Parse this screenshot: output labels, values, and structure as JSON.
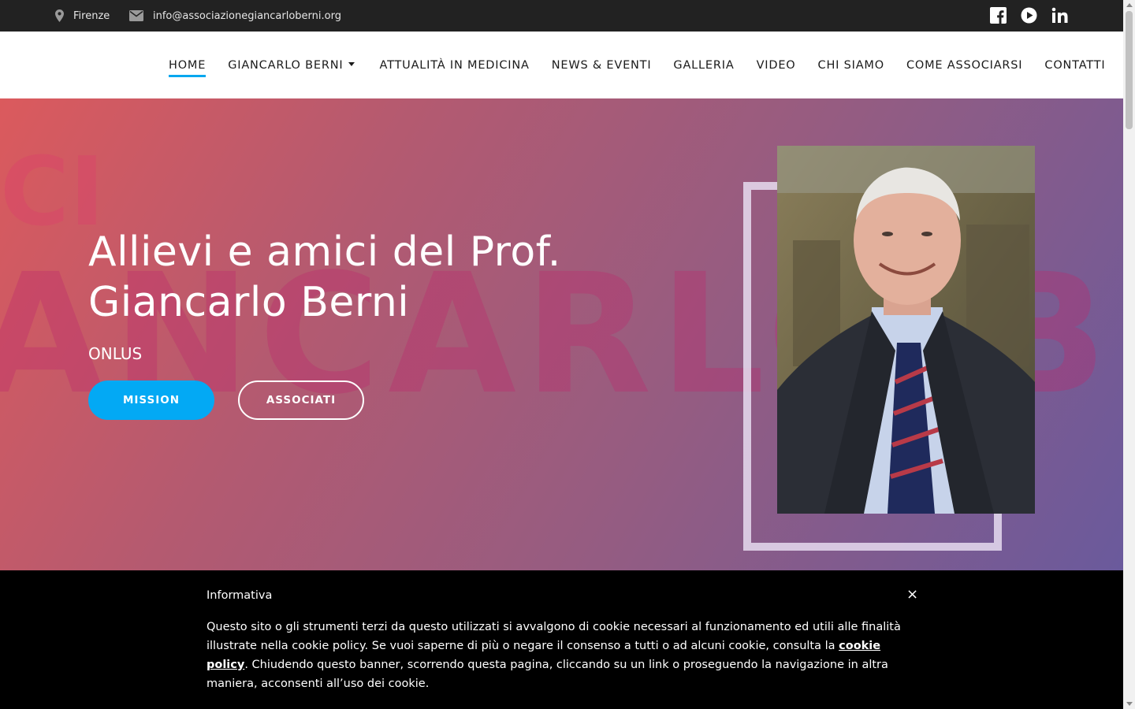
{
  "topbar": {
    "location": "Firenze",
    "email": "info@associazionegiancarloberni.org",
    "social_icons": [
      "facebook-icon",
      "play-icon",
      "linkedin-icon"
    ]
  },
  "nav": {
    "items": [
      {
        "label": "HOME"
      },
      {
        "label": "GIANCARLO BERNI"
      },
      {
        "label": "ATTUALITÀ IN MEDICINA"
      },
      {
        "label": "NEWS & EVENTI"
      },
      {
        "label": "GALLERIA"
      },
      {
        "label": "VIDEO"
      },
      {
        "label": "CHI SIAMO"
      },
      {
        "label": "COME ASSOCIARSI"
      },
      {
        "label": "CONTATTI"
      }
    ]
  },
  "hero": {
    "title_line1": "Allievi e amici del Prof.",
    "title_line2": "Giancarlo Berni",
    "subtitle": "ONLUS",
    "background_text": "ANCARLO B",
    "buttons": {
      "mission": "MISSION",
      "associati": "ASSOCIATI"
    }
  },
  "cookie": {
    "title": "Informativa",
    "close": "×",
    "text_before": "Questo sito o gli strumenti terzi da questo utilizzati si avvalgono di cookie necessari al funzionamento ed utili alle finalità illustrate nella cookie policy. Se vuoi saperne di più o negare il consenso a tutti o ad alcuni cookie, consulta la ",
    "link": "cookie policy",
    "text_after": ". Chiudendo questo banner, scorrendo questa pagina, cliccando su un link o proseguendo la navigazione in altra maniera, acconsenti all’uso dei cookie."
  },
  "colors": {
    "accent": "#00a7ef",
    "topbar_bg": "#222222",
    "cookie_bg": "#000000",
    "hero_gradient_start": "#db5a5d",
    "hero_gradient_end": "#6a5a9c"
  }
}
